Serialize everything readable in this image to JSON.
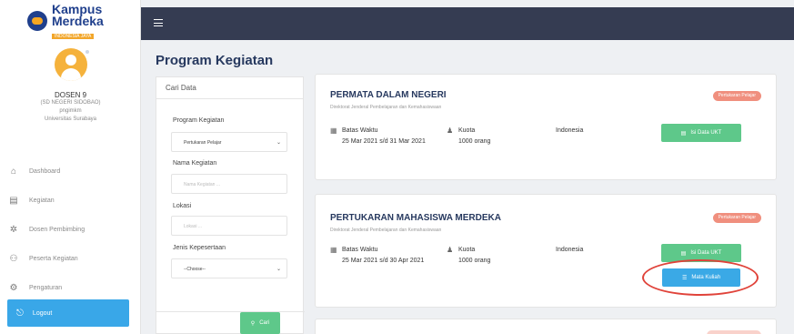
{
  "brand": {
    "line1": "Kampus",
    "line2": "Merdeka",
    "tagline": "INDONESIA JAYA"
  },
  "profile": {
    "name": "DOSEN 9",
    "school": "(SD NEGERI SIDOBAO)",
    "role": "pngimkm",
    "university": "Universitas Surabaya"
  },
  "sidebar": {
    "items": [
      {
        "label": "Dashboard",
        "icon": "⌂"
      },
      {
        "label": "Kegiatan",
        "icon": "▤"
      },
      {
        "label": "Dosen Pembimbing",
        "icon": "✲"
      },
      {
        "label": "Peserta Kegiatan",
        "icon": "⚇"
      },
      {
        "label": "Pengaturan",
        "icon": "⚙"
      }
    ],
    "logout": {
      "label": "Logout",
      "icon": "⎋"
    }
  },
  "page_title": "Program Kegiatan",
  "filter": {
    "title": "Cari Data",
    "program_label": "Program Kegiatan",
    "program_value": "Pertukaran Pelajar",
    "nama_label": "Nama Kegiatan",
    "nama_placeholder": "Nama Kegiatan ...",
    "lokasi_label": "Lokasi",
    "lokasi_placeholder": "Lokasi ...",
    "jenis_label": "Jenis Kepesertaan",
    "jenis_value": "--Choose--",
    "cari_label": "Cari"
  },
  "cards": [
    {
      "title": "PERMATA DALAM NEGERI",
      "subtitle": "Direktorat Jenderal Pembelajaran dan Kemahasiswaan",
      "badge": "Pertukaran Pelajar",
      "batas_label": "Batas Waktu",
      "batas_value": "25 Mar 2021 s/d 31 Mar 2021",
      "kuota_label": "Kuota",
      "kuota_value": "1000 orang",
      "lokasi": "Indonesia",
      "isi_btn": "Isi Data UKT"
    },
    {
      "title": "PERTUKARAN MAHASISWA MERDEKA",
      "subtitle": "Direktorat Jenderal Pembelajaran dan Kemahasiswaan",
      "badge": "Pertukaran Pelajar",
      "batas_label": "Batas Waktu",
      "batas_value": "25 Mar 2021 s/d 30 Apr 2021",
      "kuota_label": "Kuota",
      "kuota_value": "1000 orang",
      "lokasi": "Indonesia",
      "isi_btn": "Isi Data UKT",
      "mata_btn": "Mata Kuliah"
    }
  ],
  "colors": {
    "topbar": "#353c52",
    "accent_blue": "#3aa9e6",
    "accent_green": "#5ec88a",
    "badge": "#f08f7e",
    "highlight": "#e0433a"
  }
}
